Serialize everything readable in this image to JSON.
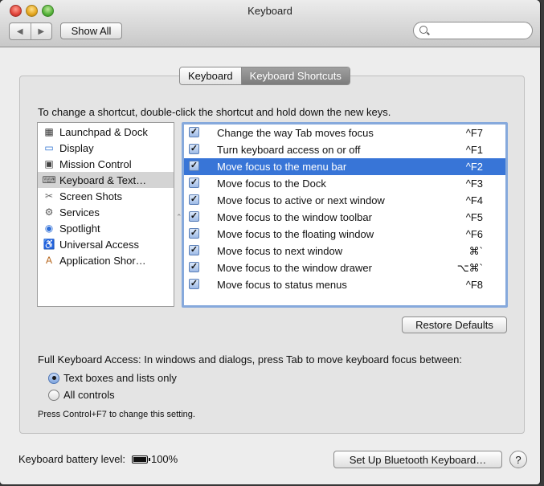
{
  "window": {
    "title": "Keyboard"
  },
  "toolbar": {
    "back": "◀",
    "forward": "▶",
    "show_all": "Show All",
    "search_placeholder": ""
  },
  "tabs": [
    {
      "label": "Keyboard",
      "active": false
    },
    {
      "label": "Keyboard Shortcuts",
      "active": true
    }
  ],
  "instructions": "To change a shortcut, double-click the shortcut and hold down the new keys.",
  "categories": [
    {
      "label": "Launchpad & Dock",
      "icon": "launchpad-icon",
      "glyph": "▦",
      "color": "#333333"
    },
    {
      "label": "Display",
      "icon": "display-icon",
      "glyph": "▭",
      "color": "#2a6fd0"
    },
    {
      "label": "Mission Control",
      "icon": "mission-control-icon",
      "glyph": "▣",
      "color": "#444444"
    },
    {
      "label": "Keyboard & Text…",
      "icon": "keyboard-icon",
      "glyph": "⌨",
      "color": "#555555"
    },
    {
      "label": "Screen Shots",
      "icon": "screenshot-icon",
      "glyph": "✂",
      "color": "#666666"
    },
    {
      "label": "Services",
      "icon": "gear-icon",
      "glyph": "⚙",
      "color": "#555555"
    },
    {
      "label": "Spotlight",
      "icon": "spotlight-icon",
      "glyph": "◉",
      "color": "#2f6fd8"
    },
    {
      "label": "Universal Access",
      "icon": "universal-access-icon",
      "glyph": "♿",
      "color": "#2f6fd8"
    },
    {
      "label": "Application Shor…",
      "icon": "application-shortcuts-icon",
      "glyph": "A",
      "color": "#b5641a"
    }
  ],
  "selected_category": 3,
  "shortcuts": [
    {
      "checked": true,
      "label": "Change the way Tab moves focus",
      "keys": "^F7"
    },
    {
      "checked": true,
      "label": "Turn keyboard access on or off",
      "keys": "^F1"
    },
    {
      "checked": true,
      "label": "Move focus to the menu bar",
      "keys": "^F2"
    },
    {
      "checked": true,
      "label": "Move focus to the Dock",
      "keys": "^F3"
    },
    {
      "checked": true,
      "label": "Move focus to active or next window",
      "keys": "^F4"
    },
    {
      "checked": true,
      "label": "Move focus to the window toolbar",
      "keys": "^F5"
    },
    {
      "checked": true,
      "label": "Move focus to the floating window",
      "keys": "^F6"
    },
    {
      "checked": true,
      "label": "Move focus to next window",
      "keys": "⌘`"
    },
    {
      "checked": true,
      "label": "Move focus to the window drawer",
      "keys": "⌥⌘`"
    },
    {
      "checked": true,
      "label": "Move focus to status menus",
      "keys": "^F8"
    }
  ],
  "selected_shortcut": 2,
  "restore_defaults": "Restore Defaults",
  "full_keyboard_access": {
    "label": "Full Keyboard Access: In windows and dialogs, press Tab to move keyboard focus between:",
    "options": [
      {
        "label": "Text boxes and lists only",
        "selected": true
      },
      {
        "label": "All controls",
        "selected": false
      }
    ],
    "hint": "Press Control+F7 to change this setting."
  },
  "battery": {
    "label": "Keyboard battery level:",
    "value": "100%"
  },
  "bluetooth_button": "Set Up Bluetooth Keyboard…",
  "help": "?"
}
